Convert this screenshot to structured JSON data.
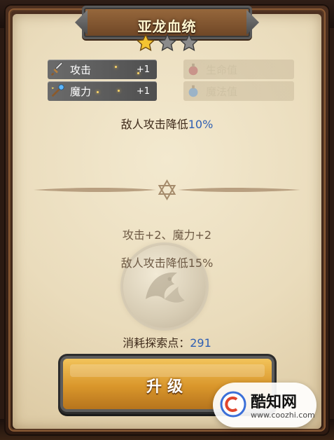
{
  "title": "亚龙血统",
  "rating": {
    "filled": 1,
    "total": 3
  },
  "stats": [
    {
      "label": "攻击",
      "value": "+1",
      "icon": "sword-icon",
      "active": true
    },
    {
      "label": "魔力",
      "value": "+1",
      "icon": "staff-icon",
      "active": true
    },
    {
      "label": "生命值",
      "value": "",
      "icon": "health-potion-icon",
      "active": false
    },
    {
      "label": "魔法值",
      "value": "",
      "icon": "mana-potion-icon",
      "active": false
    }
  ],
  "current_effect": {
    "prefix": "敌人攻击降低",
    "value": "10%"
  },
  "next_level": {
    "line1": "攻击+2、魔力+2",
    "line2": "敌人攻击降低15%"
  },
  "cost": {
    "label": "消耗探索点：",
    "value": "291"
  },
  "upgrade_button": {
    "label": "升级"
  },
  "watermark": {
    "name": "酷知网",
    "url": "www.coozhi.com"
  },
  "colors": {
    "highlight": "#2f5fb3",
    "button": "#e0a238",
    "parchment": "#eadcbc"
  }
}
